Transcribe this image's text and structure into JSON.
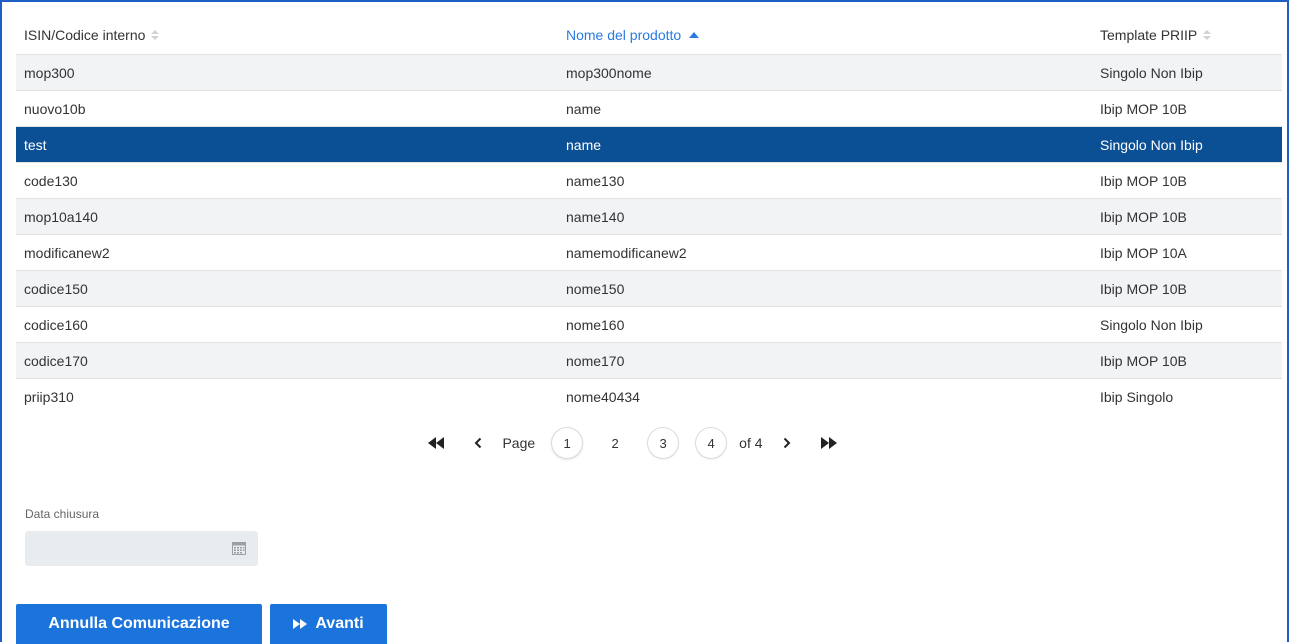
{
  "table": {
    "headers": [
      {
        "label": "ISIN/Codice interno",
        "sort": "none"
      },
      {
        "label": "Nome del prodotto",
        "sort": "asc"
      },
      {
        "label": "Template PRIIP",
        "sort": "none"
      }
    ],
    "rows": [
      {
        "code": "mop300",
        "name": "mop300nome",
        "template": "Singolo Non Ibip"
      },
      {
        "code": "nuovo10b",
        "name": "name",
        "template": "Ibip MOP 10B"
      },
      {
        "code": "test",
        "name": "name",
        "template": "Singolo Non Ibip",
        "selected": true
      },
      {
        "code": "code130",
        "name": "name130",
        "template": "Ibip MOP 10B"
      },
      {
        "code": "mop10a140",
        "name": "name140",
        "template": "Ibip MOP 10B"
      },
      {
        "code": "modificanew2",
        "name": "namemodificanew2",
        "template": "Ibip MOP 10A"
      },
      {
        "code": "codice150",
        "name": "nome150",
        "template": "Ibip MOP 10B"
      },
      {
        "code": "codice160",
        "name": "nome160",
        "template": "Singolo Non Ibip"
      },
      {
        "code": "codice170",
        "name": "nome170",
        "template": "Ibip MOP 10B"
      },
      {
        "code": "priip310",
        "name": "nome40434",
        "template": "Ibip Singolo"
      }
    ]
  },
  "pagination": {
    "page_label": "Page",
    "pages": [
      "1",
      "2",
      "3",
      "4"
    ],
    "current_page": "1",
    "of_label": "of 4"
  },
  "form": {
    "date_label": "Data chiusura",
    "date_value": ""
  },
  "buttons": {
    "annulla": "Annulla Comunicazione",
    "avanti": "Avanti"
  },
  "colors": {
    "accent": "#1b74dc",
    "selected_row": "#0b4f95",
    "sorted_header": "#2a7ae2",
    "frame_border": "#1e5fc5"
  }
}
